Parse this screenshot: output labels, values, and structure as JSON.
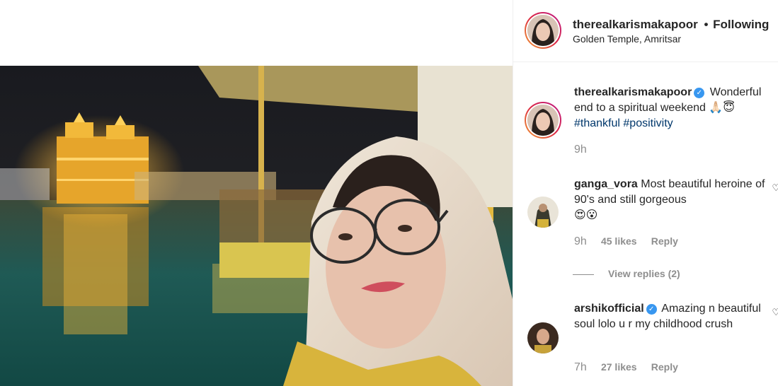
{
  "post": {
    "author": "therealkarismakapoor",
    "separator": "•",
    "follow_state": "Following",
    "location": "Golden Temple, Amritsar"
  },
  "caption": {
    "username": "therealkarismakapoor",
    "text": "Wonderful end to a spiritual weekend",
    "emoji": "🙏🏻😇",
    "hashtags": [
      "#thankful",
      "#positivity"
    ],
    "time": "9h"
  },
  "comments": [
    {
      "username": "ganga_vora",
      "text": "Most beautiful heroine of 90's and still gorgeous",
      "emoji": "😍😮",
      "time": "9h",
      "likes": "45 likes",
      "reply": "Reply",
      "view_replies": "View replies (2)"
    },
    {
      "username": "arshikofficial",
      "text": "Amazing n beautiful soul lolo u r my childhood crush",
      "time": "7h",
      "likes": "27 likes",
      "reply": "Reply"
    }
  ],
  "icons": {
    "verified": "verified-badge-icon",
    "heart": "heart-icon"
  },
  "colors": {
    "accent_link": "#00376b",
    "verified_blue": "#3897f0",
    "muted": "#8e8e8e"
  }
}
